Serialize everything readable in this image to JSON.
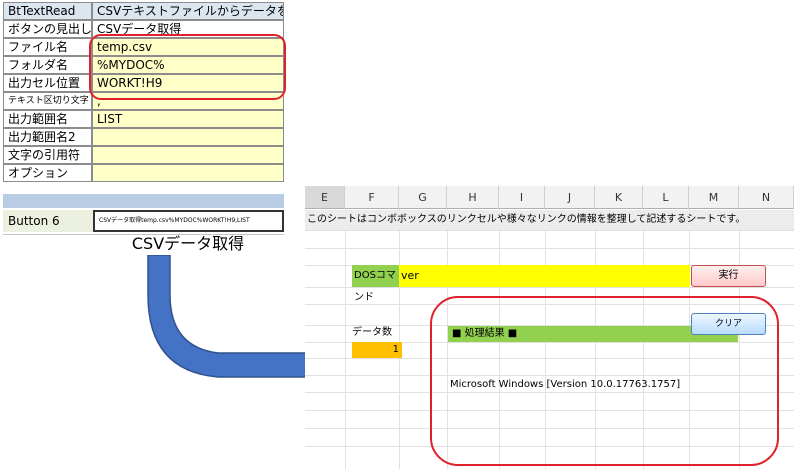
{
  "config_table": {
    "header": {
      "label": "BtTextRead",
      "value": "CSVテキストファイルからデータを取得"
    },
    "rows": [
      {
        "label": "ボタンの見出し",
        "value": "CSVデータ取得"
      },
      {
        "label": "ファイル名",
        "value": "temp.csv"
      },
      {
        "label": "フォルダ名",
        "value": "%MYDOC%"
      },
      {
        "label": "出力セル位置",
        "value": "WORKT!H9"
      },
      {
        "label": "テキスト区切り文字",
        "value": ","
      },
      {
        "label": "出力範囲名",
        "value": "LIST"
      },
      {
        "label": "出力範囲名2",
        "value": ""
      },
      {
        "label": "文字の引用符",
        "value": ""
      },
      {
        "label": "オプション",
        "value": ""
      }
    ],
    "button_row": {
      "label": "Button 6",
      "value": "CSVデータ取得temp.csv%MYDOC%WORKT!H9,LIST"
    },
    "button_caption": "CSVデータ取得"
  },
  "sheet": {
    "columns": [
      "E",
      "F",
      "G",
      "H",
      "I",
      "J",
      "K",
      "L",
      "M",
      "N"
    ],
    "selected_column": "E",
    "note": "このシートはコンボボックスのリンクセルや様々なリンクの情報を整理して記述するシートです。",
    "dos_label": "DOSコマンド",
    "dos_value": "ver",
    "exec_button": "実行",
    "clear_button": "クリア",
    "count_label": "データ数",
    "count_value": "1",
    "result_header": "■ 処理結果 ■",
    "result_text": "Microsoft Windows [Version 10.0.17763.1757]"
  },
  "colors": {
    "accent_red": "#e0202a",
    "arrow_blue": "#4472c4",
    "input_yellow": "#ffff00",
    "label_green": "#92d050",
    "count_orange": "#ffc000"
  }
}
